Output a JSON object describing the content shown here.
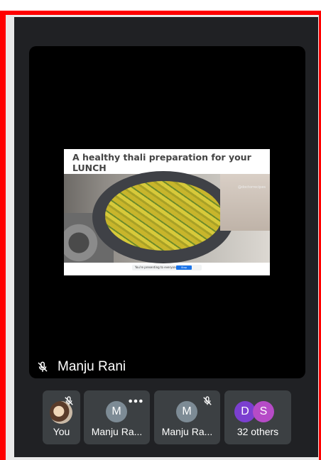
{
  "slide": {
    "title": "A healthy thali preparation for your LUNCH",
    "watermark": "@doctorrecipes",
    "share_notice": "You're presenting to everyone",
    "share_button": "Stop sharing"
  },
  "presenter": {
    "name": "Manju Rani"
  },
  "participants": [
    {
      "label": "You",
      "avatar": ""
    },
    {
      "label": "Manju Ra...",
      "avatar": "M"
    },
    {
      "label": "Manju Ra...",
      "avatar": "M"
    },
    {
      "label": "32 others",
      "avatar_d": "D",
      "avatar_s": "S"
    }
  ],
  "colors": {
    "frame": "#ff0000",
    "background": "#202124",
    "tile": "#3c4043",
    "avatar_gray": "#7d8b95",
    "avatar_purple": "#7b3fd0",
    "avatar_pink": "#b64bc7"
  }
}
